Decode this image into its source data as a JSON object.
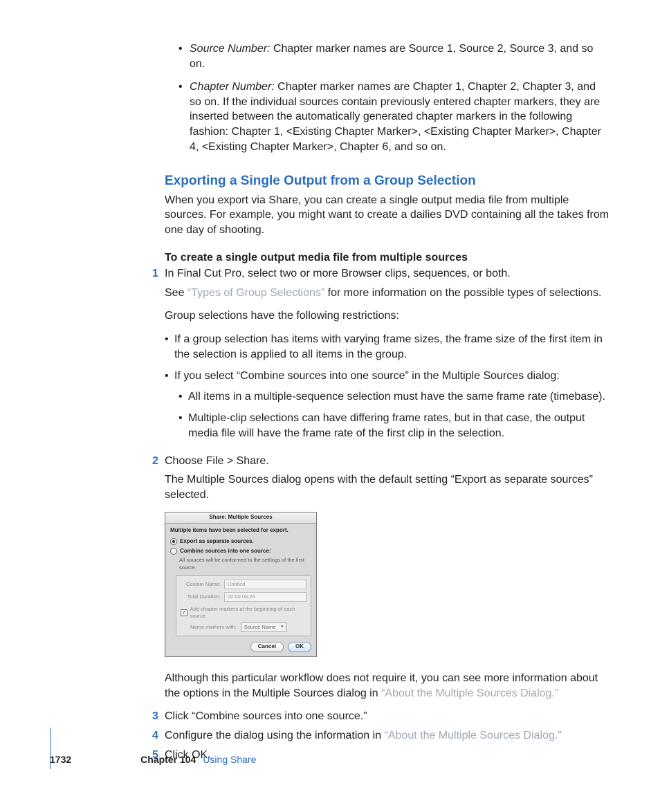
{
  "top_bullets": [
    {
      "label": "Source Number:",
      "text": "Chapter marker names are Source 1, Source 2, Source 3, and so on."
    },
    {
      "label": "Chapter Number:",
      "text": "Chapter marker names are Chapter 1, Chapter 2, Chapter 3, and so on. If the individual sources contain previously entered chapter markers, they are inserted between the automatically generated chapter markers in the following fashion: Chapter 1, <Existing Chapter Marker>, <Existing Chapter Marker>, Chapter 4, <Existing Chapter Marker>, Chapter 6, and so on."
    }
  ],
  "section_title": "Exporting a Single Output from a Group Selection",
  "intro": "When you export via Share, you can create a single output media file from multiple sources. For example, you might want to create a dailies DVD containing all the takes from one day of shooting.",
  "subheading": "To create a single output media file from multiple sources",
  "step1": {
    "num": "1",
    "text": "In Final Cut Pro, select two or more Browser clips, sequences, or both.",
    "see_pre": "See ",
    "see_link": "“Types of Group Selections”",
    "see_post": " for more information on the possible types of selections.",
    "restrictions_intro": "Group selections have the following restrictions:",
    "r1": "If a group selection has items with varying frame sizes, the frame size of the first item in the selection is applied to all items in the group.",
    "r2": "If you select “Combine sources into one source” in the Multiple Sources dialog:",
    "r2a": "All items in a multiple-sequence selection must have the same frame rate (timebase).",
    "r2b": "Multiple-clip selections can have differing frame rates, but in that case, the output media file will have the frame rate of the first clip in the selection."
  },
  "step2": {
    "num": "2",
    "text": "Choose File > Share.",
    "after": "The Multiple Sources dialog opens with the default setting “Export as separate sources” selected.",
    "post_pre": "Although this particular workflow does not require it, you can see more information about the options in the Multiple Sources dialog in ",
    "post_link": "“About the Multiple Sources Dialog.”"
  },
  "step3": {
    "num": "3",
    "text": "Click “Combine sources into one source.”"
  },
  "step4": {
    "num": "4",
    "pre": "Configure the dialog using the information in ",
    "link": "“About the Multiple Sources Dialog.”"
  },
  "step5": {
    "num": "5",
    "text": "Click OK."
  },
  "dialog": {
    "title": "Share: Multiple Sources",
    "message": "Multiple items have been selected for export.",
    "radio1": "Export as separate sources.",
    "radio2": "Combine sources into one source:",
    "note": "All sources will be conformed to the settings of the first source.",
    "custom_name_label": "Custom Name:",
    "custom_name_value": "Untitled",
    "total_duration_label": "Total Duration:",
    "total_duration_value": "00:00:08;26",
    "checkbox": "Add chapter markers at the beginning of each source",
    "name_markers_label": "Name markers with:",
    "name_markers_value": "Source Name",
    "cancel": "Cancel",
    "ok": "OK"
  },
  "footer": {
    "page": "1732",
    "chapter_label": "Chapter 104",
    "chapter_title": "Using Share"
  }
}
